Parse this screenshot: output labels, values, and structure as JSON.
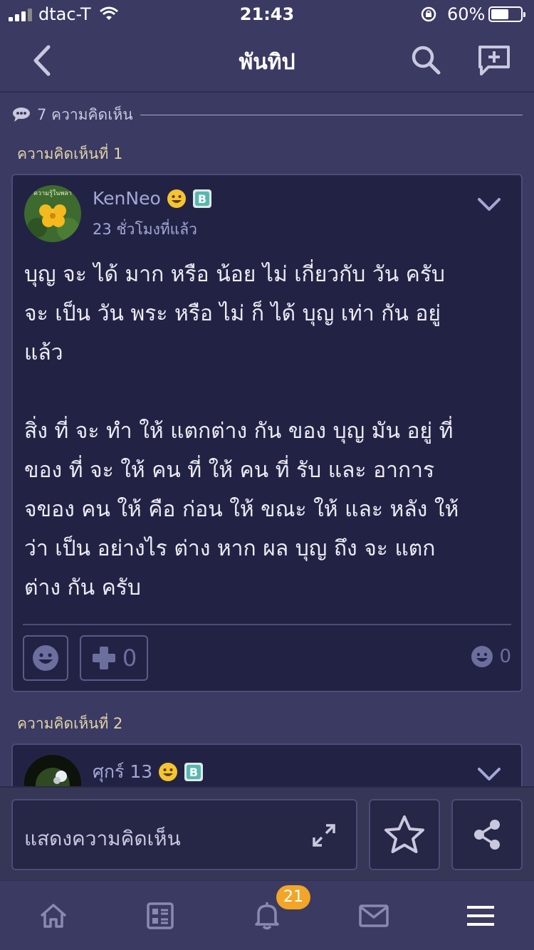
{
  "status_bar": {
    "carrier": "dtac-T",
    "time": "21:43",
    "battery_percent": "60%",
    "battery_level": 0.6
  },
  "nav": {
    "title": "พันทิป"
  },
  "comments_count_text": "7 ความคิดเห็น",
  "comments": [
    {
      "label": "ความคิดเห็นที่ 1",
      "username": "KenNeo",
      "avatar_text": "ความรู้ในพลา",
      "time_ago": "23 ชั่วโมงที่แล้ว",
      "body": "บุญ จะ ได้ มาก หรือ น้อย ไม่ เกี่ยวกับ วัน ครับ\nจะ เป็น วัน พระ หรือ ไม่ ก็ ได้ บุญ เท่า กัน อยู่\nแล้ว\n\nสิ่ง ที่ จะ ทำ ให้ แตกต่าง กัน ของ บุญ มัน อยู่ ที่\nของ ที่ จะ ให้ คน ที่ ให้ คน ที่ รับ และ อาการ\nจของ คน ให้ คือ ก่อน ให้ ขณะ ให้ และ หลัง ให้\nว่า เป็น อย่างไร ต่าง หาก ผล บุญ ถึง จะ แตก\nต่าง กัน ครับ",
      "plus_count": "0",
      "reaction_count": "0"
    },
    {
      "label": "ความคิดเห็นที่ 2",
      "username": "ศุกร์ 13"
    }
  ],
  "comment_bar": {
    "placeholder": "แสดงความคิดเห็น"
  },
  "tabs": {
    "notifications_badge": "21"
  },
  "colors": {
    "background": "#3a3a63",
    "card": "#222344",
    "accent_label": "#e0d3a6",
    "username": "#a4a7d6",
    "badge": "#f2a526",
    "emoji_yellow": "#f6c431",
    "b_badge": "#57b8b0"
  },
  "icons": [
    "back-icon",
    "search-icon",
    "compose-icon",
    "speech-bubble-icon",
    "emoji-icon",
    "b-badge-icon",
    "chevron-down-icon",
    "plus-icon",
    "expand-icon",
    "star-icon",
    "share-icon",
    "home-icon",
    "feed-icon",
    "bell-icon",
    "mail-icon",
    "menu-icon"
  ]
}
